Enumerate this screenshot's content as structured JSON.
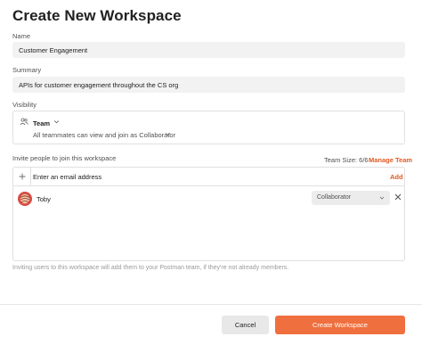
{
  "dialog": {
    "title": "Create New Workspace"
  },
  "name": {
    "label": "Name",
    "value": "Customer Engagement"
  },
  "summary": {
    "label": "Summary",
    "value": "APIs for customer engagement throughout the CS org"
  },
  "visibility": {
    "label": "Visibility",
    "selected": "Team",
    "icon": "team-icon",
    "access_text": "All teammates can view and join as Collaborator"
  },
  "invite": {
    "label": "Invite people to join this workspace",
    "team_size": "Team Size: 6/6",
    "manage_link": "Manage Team",
    "email_placeholder": "Enter an email address",
    "add_label": "Add",
    "members": [
      {
        "name": "Toby",
        "role": "Collaborator"
      }
    ],
    "note": "Inviting users to this workspace will add them to your Postman team, if they're not already members."
  },
  "footer": {
    "cancel_label": "Cancel",
    "create_label": "Create Workspace"
  },
  "colors": {
    "accent": "#e05a24",
    "primary_button": "#ef6f3e"
  }
}
